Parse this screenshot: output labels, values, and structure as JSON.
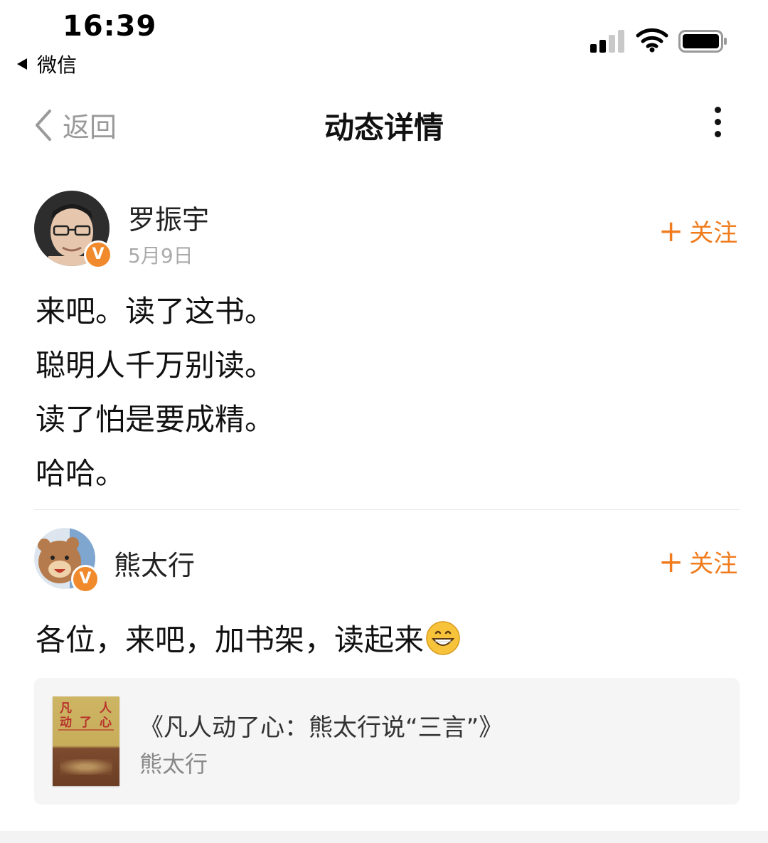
{
  "status_bar": {
    "time": "16:39",
    "back_app": "微信"
  },
  "nav": {
    "back_label": "返回",
    "title": "动态详情"
  },
  "post": {
    "author": "罗振宇",
    "date": "5月9日",
    "follow_label": "关注",
    "lines": [
      "来吧。读了这书。",
      "聪明人千万别读。",
      "读了怕是要成精。",
      "哈哈。"
    ]
  },
  "comment": {
    "author": "熊太行",
    "follow_label": "关注",
    "text": "各位，来吧，加书架，读起来",
    "emoji": "grinning-face-icon",
    "book": {
      "title": "《凡人动了心：熊太行说“三言”》",
      "author": "熊太行",
      "cover_text": [
        "凡",
        "人",
        "动",
        "了",
        "心"
      ]
    }
  },
  "colors": {
    "accent": "#f07c1e",
    "verified_badge": "#f08a2c",
    "muted": "#9a9a9a"
  }
}
